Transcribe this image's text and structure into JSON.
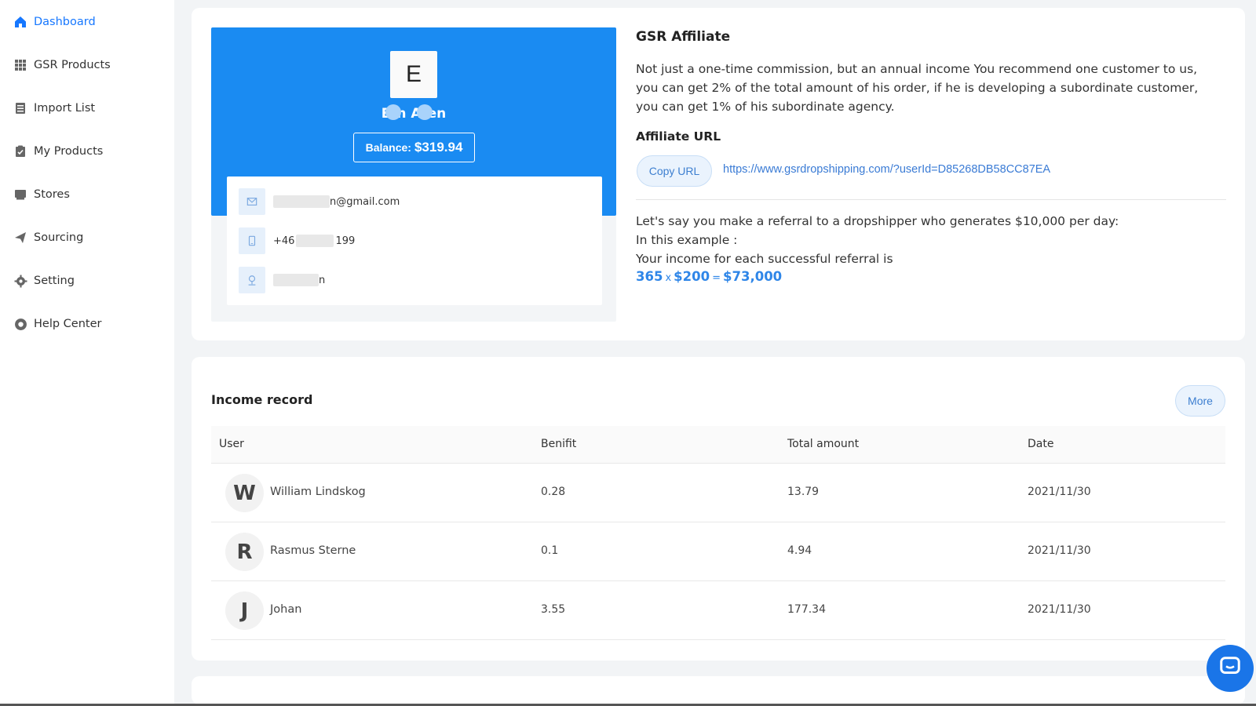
{
  "sidebar": {
    "items": [
      {
        "label": "Dashboard",
        "icon": "home-icon",
        "active": true
      },
      {
        "label": "GSR Products",
        "icon": "grid-icon"
      },
      {
        "label": "Import List",
        "icon": "list-icon"
      },
      {
        "label": "My Products",
        "icon": "clipboard-icon"
      },
      {
        "label": "Stores",
        "icon": "store-icon"
      },
      {
        "label": "Sourcing",
        "icon": "paper-plane-icon"
      },
      {
        "label": "Setting",
        "icon": "gear-icon"
      },
      {
        "label": "Help Center",
        "icon": "help-icon"
      }
    ]
  },
  "profile": {
    "avatar_letter": "E",
    "name_parts": [
      "E",
      "n A",
      "en"
    ],
    "balance_label": "Balance:",
    "balance_value": "$319.94",
    "email_suffix": "n@gmail.com",
    "phone_prefix": "+46",
    "phone_suffix": "199",
    "address_suffix": "n"
  },
  "affiliate": {
    "title": "GSR Affiliate",
    "description": "Not just a one-time commission, but an annual income You recommend one customer to us, you can get 2% of the total amount of his order, if he is developing a subordinate customer, you can get 1% of his subordinate agency.",
    "url_title": "Affiliate URL",
    "copy_button": "Copy URL",
    "url": "https://www.gsrdropshipping.com/?userId=D85268DB58CC87EA",
    "example_line1": "Let's say you make a referral to a dropshipper who generates $10,000 per day:",
    "example_line2": "In this example :",
    "example_line3": "Your income for each successful referral is",
    "formula_a": "365",
    "formula_op1": "x",
    "formula_b": "$200",
    "formula_op2": "=",
    "formula_result": "$73,000"
  },
  "income": {
    "title": "Income record",
    "more_button": "More",
    "columns": [
      "User",
      "Benifit",
      "Total amount",
      "Date"
    ],
    "rows": [
      {
        "initial": "W",
        "user": "William Lindskog",
        "benefit": "0.28",
        "total": "13.79",
        "date": "2021/11/30"
      },
      {
        "initial": "R",
        "user": "Rasmus Sterne",
        "benefit": "0.1",
        "total": "4.94",
        "date": "2021/11/30"
      },
      {
        "initial": "J",
        "user": "Johan",
        "benefit": "3.55",
        "total": "177.34",
        "date": "2021/11/30"
      }
    ]
  },
  "colors": {
    "accent": "#1a8bf2",
    "link": "#3a7bd5",
    "chat": "#1a75e8"
  }
}
